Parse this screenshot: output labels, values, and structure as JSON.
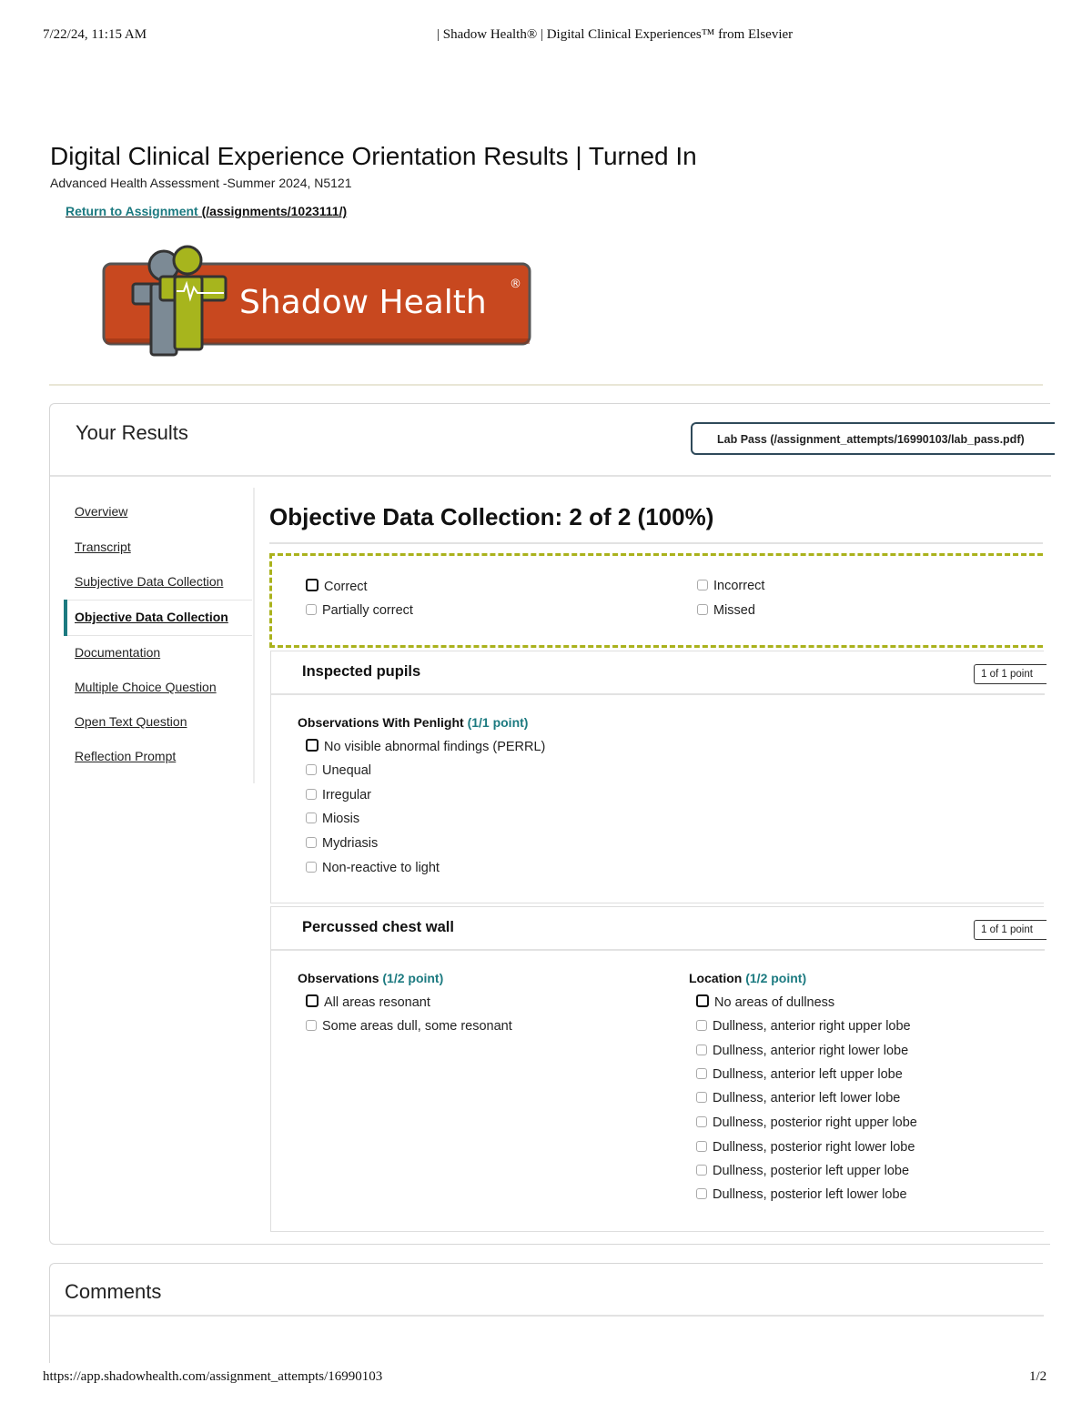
{
  "print_header": {
    "date": "7/22/24, 11:15 AM",
    "title": "| Shadow Health® | Digital Clinical Experiences™ from Elsevier"
  },
  "print_footer": {
    "url": "https://app.shadowhealth.com/assignment_attempts/16990103",
    "page": "1/2"
  },
  "page": {
    "title": "Digital Clinical Experience Orientation Results | Turned In",
    "course": "Advanced Health Assessment -Summer 2024, N5121",
    "return_link_label": "Return to Assignment",
    "return_link_url": " (/assignments/1023111/)"
  },
  "logo": {
    "text": "Shadow Health",
    "registered": "®"
  },
  "results": {
    "title": "Your Results",
    "lab_pass": "Lab Pass (/assignment_attempts/16990103/lab_pass.pdf)"
  },
  "sidenav": {
    "items": [
      "Overview",
      "Transcript",
      "Subjective Data Collection",
      "Objective Data Collection",
      "Documentation",
      "Multiple Choice Question",
      "Open Text Question",
      "Reflection Prompt"
    ],
    "active_index": 3
  },
  "section": {
    "title": "Objective Data Collection: 2 of 2 (100%)"
  },
  "legend": {
    "correct": "Correct",
    "incorrect": "Incorrect",
    "partially_correct": "Partially correct",
    "missed": "Missed"
  },
  "items": [
    {
      "title": "Inspected pupils",
      "points": "1 of 1 point",
      "groups": [
        {
          "label": "Observations With Penlight",
          "points": "(1/1 point)",
          "options": [
            {
              "text": "No visible abnormal findings (PERRL)",
              "checked": true
            },
            {
              "text": "Unequal",
              "checked": false
            },
            {
              "text": "Irregular",
              "checked": false
            },
            {
              "text": "Miosis",
              "checked": false
            },
            {
              "text": "Mydriasis",
              "checked": false
            },
            {
              "text": "Non-reactive to light",
              "checked": false
            }
          ]
        }
      ]
    },
    {
      "title": "Percussed chest wall",
      "points": "1 of 1 point",
      "groups": [
        {
          "label": "Observations",
          "points": "(1/2 point)",
          "options": [
            {
              "text": "All areas resonant",
              "checked": true
            },
            {
              "text": "Some areas dull, some resonant",
              "checked": false
            }
          ]
        },
        {
          "label": "Location",
          "points": "(1/2 point)",
          "options": [
            {
              "text": "No areas of dullness",
              "checked": true
            },
            {
              "text": "Dullness, anterior right upper lobe",
              "checked": false
            },
            {
              "text": "Dullness, anterior right lower lobe",
              "checked": false
            },
            {
              "text": "Dullness, anterior left upper lobe",
              "checked": false
            },
            {
              "text": "Dullness, anterior left lower lobe",
              "checked": false
            },
            {
              "text": "Dullness, posterior right upper lobe",
              "checked": false
            },
            {
              "text": "Dullness, posterior right lower lobe",
              "checked": false
            },
            {
              "text": "Dullness, posterior left upper lobe",
              "checked": false
            },
            {
              "text": "Dullness, posterior left lower lobe",
              "checked": false
            }
          ]
        }
      ]
    }
  ],
  "comments": {
    "title": "Comments"
  },
  "colors": {
    "accent_teal": "#1c7a80",
    "legend_border": "#aab21c",
    "logo_orange": "#c8481f",
    "logo_green": "#a7b51d"
  }
}
